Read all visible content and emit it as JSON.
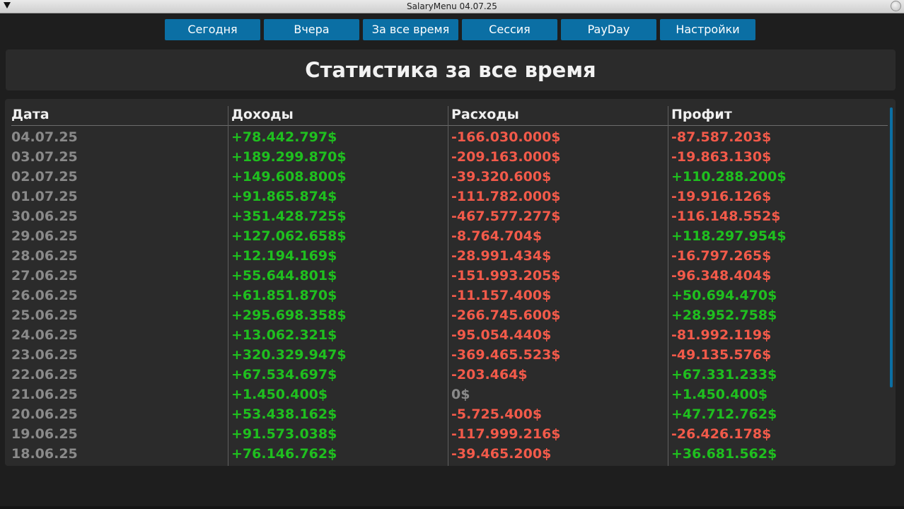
{
  "window": {
    "title": "SalaryMenu 04.07.25"
  },
  "tabs": [
    {
      "label": "Сегодня"
    },
    {
      "label": "Вчера"
    },
    {
      "label": "За все время"
    },
    {
      "label": "Сессия"
    },
    {
      "label": "PayDay"
    },
    {
      "label": "Настройки"
    }
  ],
  "heading": "Статистика за все время",
  "table": {
    "columns": [
      "Дата",
      "Доходы",
      "Расходы",
      "Профит"
    ],
    "rows": [
      [
        "04.07.25",
        "+78.442.797$",
        "-166.030.000$",
        "-87.587.203$"
      ],
      [
        "03.07.25",
        "+189.299.870$",
        "-209.163.000$",
        "-19.863.130$"
      ],
      [
        "02.07.25",
        "+149.608.800$",
        "-39.320.600$",
        "+110.288.200$"
      ],
      [
        "01.07.25",
        "+91.865.874$",
        "-111.782.000$",
        "-19.916.126$"
      ],
      [
        "30.06.25",
        "+351.428.725$",
        "-467.577.277$",
        "-116.148.552$"
      ],
      [
        "29.06.25",
        "+127.062.658$",
        "-8.764.704$",
        "+118.297.954$"
      ],
      [
        "28.06.25",
        "+12.194.169$",
        "-28.991.434$",
        "-16.797.265$"
      ],
      [
        "27.06.25",
        "+55.644.801$",
        "-151.993.205$",
        "-96.348.404$"
      ],
      [
        "26.06.25",
        "+61.851.870$",
        "-11.157.400$",
        "+50.694.470$"
      ],
      [
        "25.06.25",
        "+295.698.358$",
        "-266.745.600$",
        "+28.952.758$"
      ],
      [
        "24.06.25",
        "+13.062.321$",
        "-95.054.440$",
        "-81.992.119$"
      ],
      [
        "23.06.25",
        "+320.329.947$",
        "-369.465.523$",
        "-49.135.576$"
      ],
      [
        "22.06.25",
        "+67.534.697$",
        "-203.464$",
        "+67.331.233$"
      ],
      [
        "21.06.25",
        "+1.450.400$",
        "0$",
        "+1.450.400$"
      ],
      [
        "20.06.25",
        "+53.438.162$",
        "-5.725.400$",
        "+47.712.762$"
      ],
      [
        "19.06.25",
        "+91.573.038$",
        "-117.999.216$",
        "-26.426.178$"
      ],
      [
        "18.06.25",
        "+76.146.762$",
        "-39.465.200$",
        "+36.681.562$"
      ]
    ]
  },
  "colors": {
    "positive": "#1fbf1f",
    "negative": "#f25a4a",
    "neutral": "#8a8a8a",
    "accent": "#0b6fa4"
  }
}
